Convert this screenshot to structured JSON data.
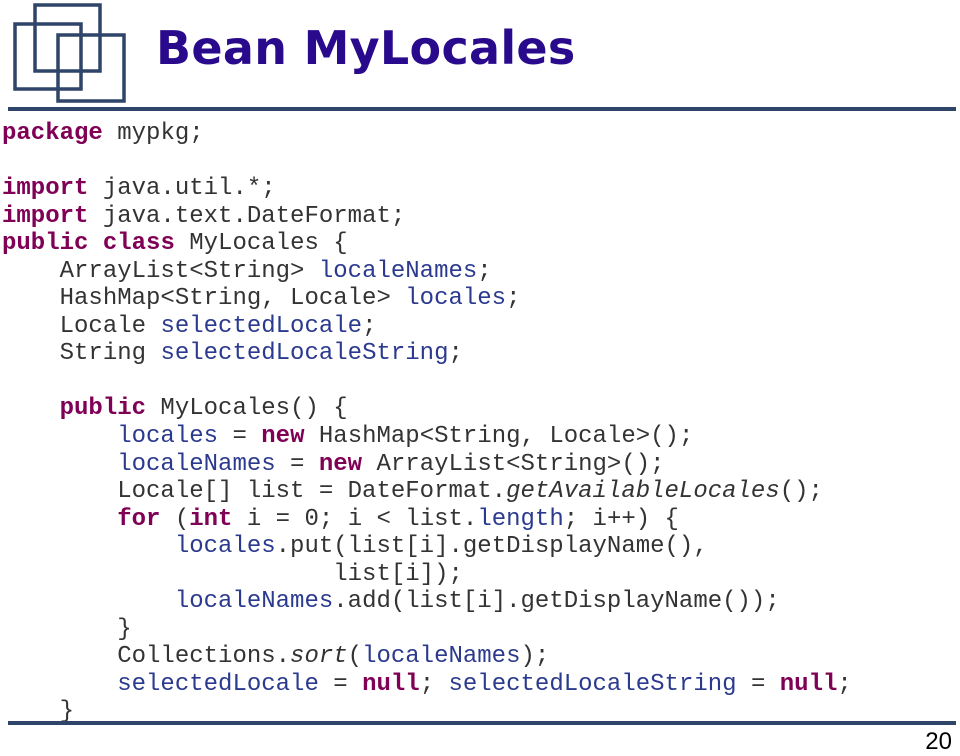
{
  "slide": {
    "title": "Bean MyLocales",
    "page_number": "20",
    "logo_icon": "overlapping-squares-logo"
  },
  "colors": {
    "title": "#2a0a8c",
    "keyword": "#7f0055",
    "field": "#2b3a8e",
    "plain": "#333333",
    "rule": "#2e4468"
  },
  "code": {
    "lines": [
      [
        {
          "t": "package",
          "k": "kw"
        },
        {
          "t": " mypkg;",
          "k": ""
        }
      ],
      [],
      [
        {
          "t": "import",
          "k": "kw"
        },
        {
          "t": " java.util.*;",
          "k": ""
        }
      ],
      [
        {
          "t": "import",
          "k": "kw"
        },
        {
          "t": " java.text.DateFormat;",
          "k": ""
        }
      ],
      [
        {
          "t": "public",
          "k": "kw"
        },
        {
          "t": " ",
          "k": ""
        },
        {
          "t": "class",
          "k": "kw"
        },
        {
          "t": " MyLocales {",
          "k": ""
        }
      ],
      [
        {
          "t": "    ArrayList<String> ",
          "k": ""
        },
        {
          "t": "localeNames",
          "k": "fld"
        },
        {
          "t": ";",
          "k": ""
        }
      ],
      [
        {
          "t": "    HashMap<String, Locale> ",
          "k": ""
        },
        {
          "t": "locales",
          "k": "fld"
        },
        {
          "t": ";",
          "k": ""
        }
      ],
      [
        {
          "t": "    Locale ",
          "k": ""
        },
        {
          "t": "selectedLocale",
          "k": "fld"
        },
        {
          "t": ";",
          "k": ""
        }
      ],
      [
        {
          "t": "    String ",
          "k": ""
        },
        {
          "t": "selectedLocaleString",
          "k": "fld"
        },
        {
          "t": ";",
          "k": ""
        }
      ],
      [],
      [
        {
          "t": "    ",
          "k": ""
        },
        {
          "t": "public",
          "k": "kw"
        },
        {
          "t": " MyLocales() {",
          "k": ""
        }
      ],
      [
        {
          "t": "        ",
          "k": ""
        },
        {
          "t": "locales",
          "k": "fld"
        },
        {
          "t": " = ",
          "k": ""
        },
        {
          "t": "new",
          "k": "kw"
        },
        {
          "t": " HashMap<String, Locale>();",
          "k": ""
        }
      ],
      [
        {
          "t": "        ",
          "k": ""
        },
        {
          "t": "localeNames",
          "k": "fld"
        },
        {
          "t": " = ",
          "k": ""
        },
        {
          "t": "new",
          "k": "kw"
        },
        {
          "t": " ArrayList<String>();",
          "k": ""
        }
      ],
      [
        {
          "t": "        Locale[] list = DateFormat.",
          "k": ""
        },
        {
          "t": "getAvailableLocales",
          "k": "it"
        },
        {
          "t": "();",
          "k": ""
        }
      ],
      [
        {
          "t": "        ",
          "k": ""
        },
        {
          "t": "for",
          "k": "kw"
        },
        {
          "t": " (",
          "k": ""
        },
        {
          "t": "int",
          "k": "kw"
        },
        {
          "t": " i = 0; i < list.",
          "k": ""
        },
        {
          "t": "length",
          "k": "fld"
        },
        {
          "t": "; i++) {",
          "k": ""
        }
      ],
      [
        {
          "t": "            ",
          "k": ""
        },
        {
          "t": "locales",
          "k": "fld"
        },
        {
          "t": ".put(list[i].getDisplayName(),",
          "k": ""
        }
      ],
      [
        {
          "t": "                       list[i]);",
          "k": ""
        }
      ],
      [
        {
          "t": "            ",
          "k": ""
        },
        {
          "t": "localeNames",
          "k": "fld"
        },
        {
          "t": ".add(list[i].getDisplayName());",
          "k": ""
        }
      ],
      [
        {
          "t": "        }",
          "k": ""
        }
      ],
      [
        {
          "t": "        Collections.",
          "k": ""
        },
        {
          "t": "sort",
          "k": "it"
        },
        {
          "t": "(",
          "k": ""
        },
        {
          "t": "localeNames",
          "k": "fld"
        },
        {
          "t": ");",
          "k": ""
        }
      ],
      [
        {
          "t": "        ",
          "k": ""
        },
        {
          "t": "selectedLocale",
          "k": "fld"
        },
        {
          "t": " = ",
          "k": ""
        },
        {
          "t": "null",
          "k": "kw"
        },
        {
          "t": "; ",
          "k": ""
        },
        {
          "t": "selectedLocaleString",
          "k": "fld"
        },
        {
          "t": " = ",
          "k": ""
        },
        {
          "t": "null",
          "k": "kw"
        },
        {
          "t": ";",
          "k": ""
        }
      ],
      [
        {
          "t": "    }",
          "k": ""
        }
      ]
    ]
  }
}
